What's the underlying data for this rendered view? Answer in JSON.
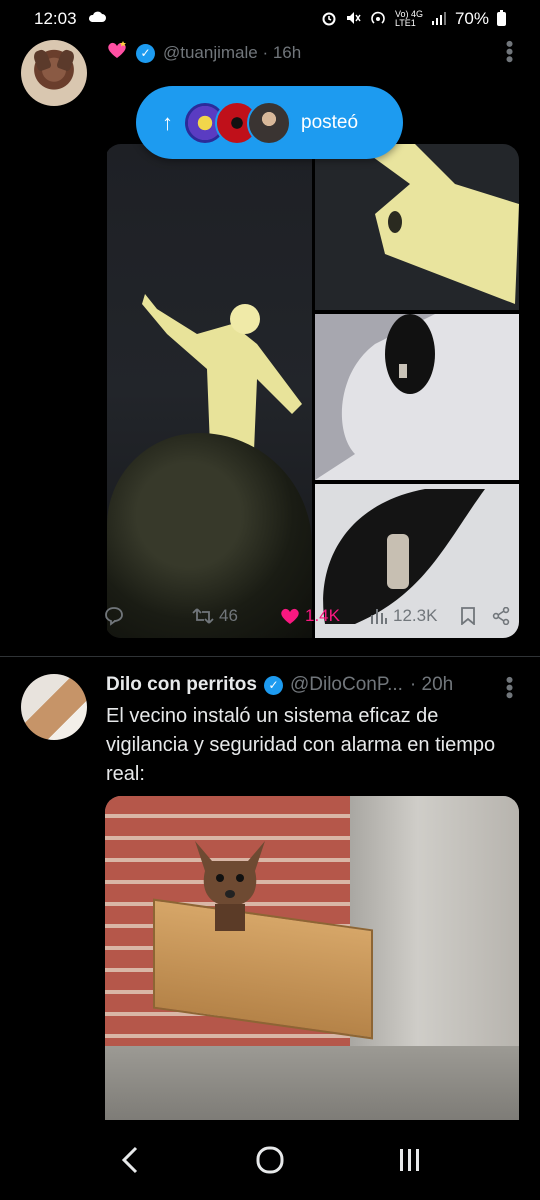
{
  "status_bar": {
    "time": "12:03",
    "network_label": "Vo) 4G",
    "network_sub": "LTE1",
    "battery": "70%"
  },
  "tweet1": {
    "handle": "@tuanjimale · 16h",
    "posted_pill": {
      "label": "posteó"
    },
    "actions": {
      "retweets": "46",
      "likes": "1.4K",
      "views": "12.3K"
    }
  },
  "tweet2": {
    "name": "Dilo con perritos",
    "handle": "@DiloConP...",
    "time": "· 20h",
    "text": "El vecino instaló un sistema eficaz de vigilancia y seguridad con alarma en tiempo real:"
  },
  "colors": {
    "accent": "#1d9bf0",
    "like": "#f91880",
    "muted": "#71767b",
    "text": "#e7e9ea",
    "background": "#000000"
  }
}
